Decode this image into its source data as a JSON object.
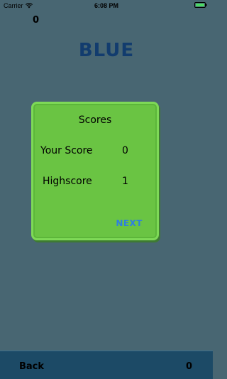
{
  "status_bar": {
    "carrier": "Carrier",
    "time": "6:08 PM",
    "wifi_icon": "wifi-icon",
    "battery_icon": "battery-icon"
  },
  "game": {
    "current_score": "0",
    "color_word": "BLUE",
    "color_word_color": "#123c6e"
  },
  "scores_panel": {
    "title": "Scores",
    "your_score_label": "Your Score",
    "your_score_value": "0",
    "highscore_label": "Highscore",
    "highscore_value": "1",
    "next_label": "NEXT"
  },
  "bottom_bar": {
    "back_label": "Back",
    "score": "0"
  },
  "colors": {
    "background": "#486672",
    "panel": "#6ac443",
    "panel_border": "#7ed957",
    "next": "#2f7fe0",
    "bottom_bar": "#1c4a66",
    "battery": "#4cd964"
  }
}
